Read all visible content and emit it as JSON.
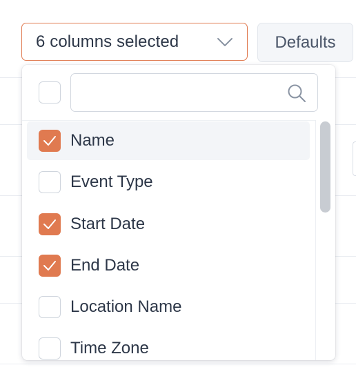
{
  "column_selector": {
    "label": "6 columns selected",
    "chevron_icon": "chevron-down-icon",
    "border_color": "#e07a50"
  },
  "defaults_button": {
    "label": "Defaults"
  },
  "dropdown": {
    "search": {
      "value": "",
      "placeholder": "",
      "icon": "search-icon"
    },
    "select_all_checked": false,
    "options": [
      {
        "label": "Name",
        "checked": true,
        "highlighted": true
      },
      {
        "label": "Event Type",
        "checked": false,
        "highlighted": false
      },
      {
        "label": "Start Date",
        "checked": true,
        "highlighted": false
      },
      {
        "label": "End Date",
        "checked": true,
        "highlighted": false
      },
      {
        "label": "Location Name",
        "checked": false,
        "highlighted": false
      },
      {
        "label": "Time Zone",
        "checked": false,
        "highlighted": false
      }
    ],
    "checked_color": "#e07a50"
  }
}
